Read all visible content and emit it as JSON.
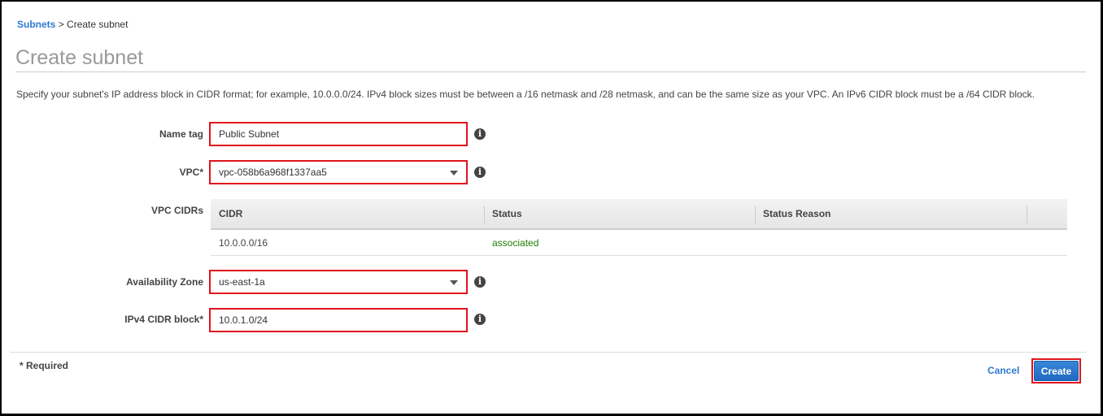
{
  "breadcrumb": {
    "parent": "Subnets",
    "separator": ">",
    "current": "Create subnet"
  },
  "page_title": "Create subnet",
  "description": "Specify your subnet's IP address block in CIDR format; for example, 10.0.0.0/24. IPv4 block sizes must be between a /16 netmask and /28 netmask, and can be the same size as your VPC. An IPv6 CIDR block must be a /64 CIDR block.",
  "form": {
    "name_tag": {
      "label": "Name tag",
      "value": "Public Subnet",
      "info_icon": "info-icon"
    },
    "vpc": {
      "label": "VPC*",
      "value": "vpc-058b6a968f1337aa5",
      "info_icon": "info-icon"
    },
    "vpc_cidrs": {
      "label": "VPC CIDRs",
      "columns": [
        "CIDR",
        "Status",
        "Status Reason"
      ],
      "rows": [
        {
          "cidr": "10.0.0.0/16",
          "status": "associated",
          "status_reason": ""
        }
      ]
    },
    "availability_zone": {
      "label": "Availability Zone",
      "value": "us-east-1a",
      "info_icon": "info-icon"
    },
    "ipv4_cidr": {
      "label": "IPv4 CIDR block*",
      "value": "10.0.1.0/24",
      "info_icon": "info-icon"
    }
  },
  "footer": {
    "required_note": "* Required",
    "cancel_label": "Cancel",
    "create_label": "Create"
  },
  "colors": {
    "link": "#2e7ad1",
    "highlight_border": "#e0141e",
    "status_ok": "#1d8102",
    "primary_button": "#1f69c1"
  }
}
